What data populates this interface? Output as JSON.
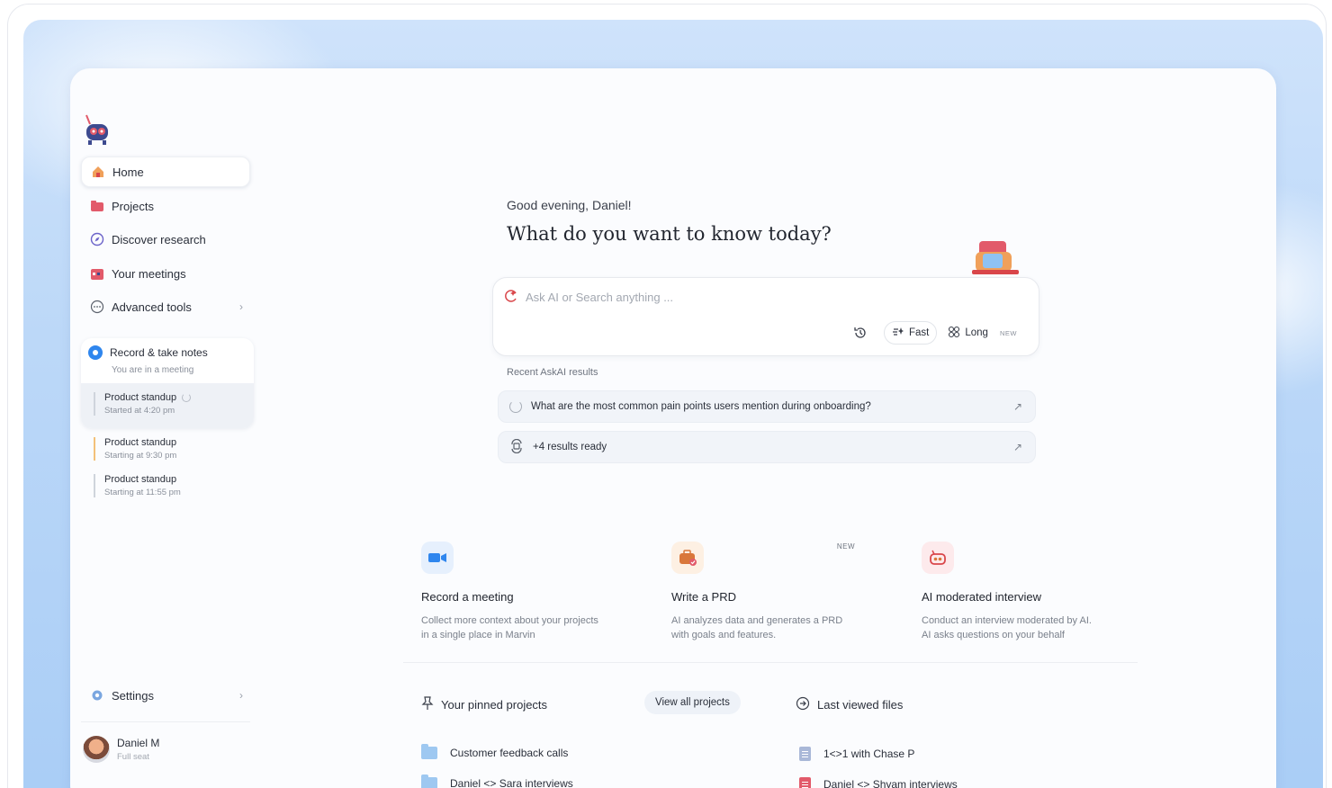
{
  "sidebar": {
    "nav": [
      {
        "label": "Home",
        "icon": "home-icon"
      },
      {
        "label": "Projects",
        "icon": "projects-icon"
      },
      {
        "label": "Discover research",
        "icon": "compass-icon"
      },
      {
        "label": "Your meetings",
        "icon": "calendar-icon"
      },
      {
        "label": "Advanced tools",
        "icon": "more-icon"
      }
    ],
    "record": {
      "title": "Record & take notes",
      "subtitle": "You are in a meeting"
    },
    "meetings": [
      {
        "title": "Product standup",
        "time": "Started at 4:20 pm"
      },
      {
        "title": "Product standup",
        "time": "Starting at 9:30 pm"
      },
      {
        "title": "Product standup",
        "time": "Starting at 11:55 pm"
      }
    ],
    "settings_label": "Settings",
    "user": {
      "name": "Daniel M",
      "seat": "Full seat"
    }
  },
  "main": {
    "greeting": "Good evening, Daniel!",
    "question": "What do you want to know today?",
    "search": {
      "placeholder": "Ask AI or Search anything ...",
      "mode_fast": "Fast",
      "mode_long": "Long",
      "new_tag": "NEW"
    },
    "recent_label": "Recent AskAI results",
    "recent": [
      {
        "text": "What are the most common pain points users mention during onboarding?"
      },
      {
        "text": "+4 results ready"
      }
    ],
    "cards": [
      {
        "title": "Record a meeting",
        "desc": "Collect more context about your projects in a single place in Marvin",
        "color": "#2f86ee"
      },
      {
        "title": "Write a PRD",
        "desc": "AI analyzes data and generates a PRD with goals and features.",
        "new": "NEW",
        "color": "#e38b3a"
      },
      {
        "title": "AI moderated interview",
        "desc": "Conduct an interview moderated by AI. AI asks questions on your behalf",
        "color": "#d9464a"
      }
    ],
    "pinned_label": "Your pinned projects",
    "view_all_label": "View all projects",
    "last_viewed_label": "Last viewed files",
    "pinned_files": [
      "Customer feedback calls",
      "Daniel <> Sara interviews"
    ],
    "last_files": [
      "1<>1 with Chase P",
      "Daniel <> Shyam interviews"
    ]
  }
}
